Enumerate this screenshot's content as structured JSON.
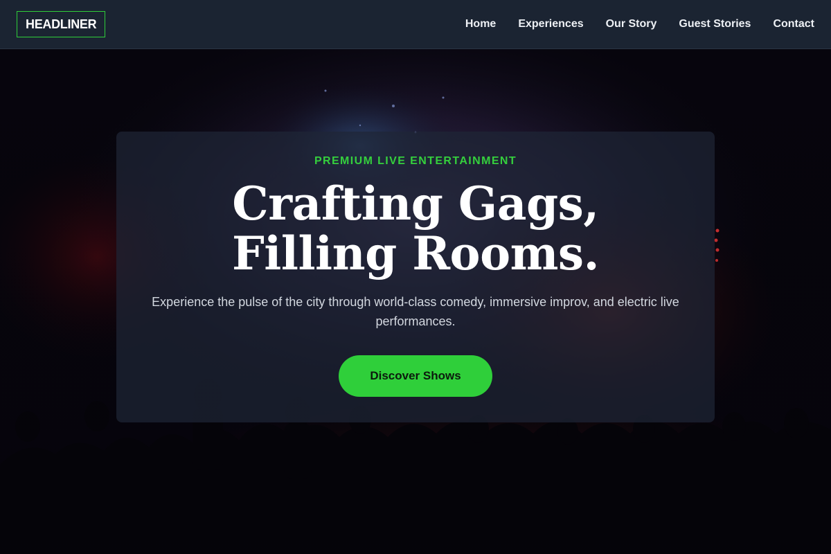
{
  "header": {
    "logo": "HEADLINER",
    "nav": [
      {
        "label": "Home"
      },
      {
        "label": "Experiences"
      },
      {
        "label": "Our Story"
      },
      {
        "label": "Guest Stories"
      },
      {
        "label": "Contact"
      }
    ]
  },
  "hero": {
    "eyebrow": "PREMIUM LIVE ENTERTAINMENT",
    "headline_line1": "Crafting Gags,",
    "headline_line2": "Filling Rooms.",
    "subtitle": "Experience the pulse of the city through world-class comedy, immersive improv, and electric live performances.",
    "cta_label": "Discover Shows",
    "background_image": "concert-crowd-silhouette"
  },
  "colors": {
    "accent": "#2fcf3a",
    "header_bg": "#1b2432",
    "card_bg": "#1e2636"
  }
}
